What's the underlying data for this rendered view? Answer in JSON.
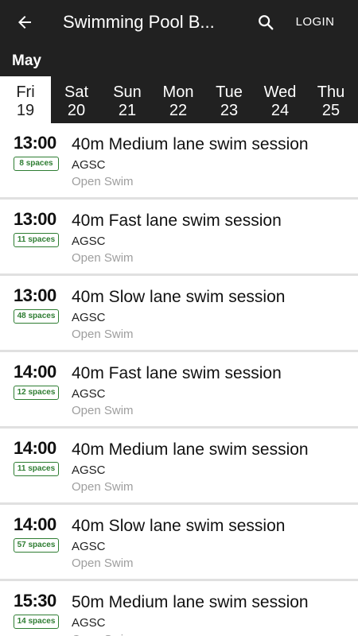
{
  "header": {
    "title": "Swimming Pool B...",
    "login_label": "LOGIN",
    "back_icon": "arrow-left-icon",
    "search_icon": "search-icon",
    "background": "#212121"
  },
  "month": "May",
  "days": [
    {
      "name": "Fri",
      "num": "19",
      "selected": true
    },
    {
      "name": "Sat",
      "num": "20",
      "selected": false
    },
    {
      "name": "Sun",
      "num": "21",
      "selected": false
    },
    {
      "name": "Mon",
      "num": "22",
      "selected": false
    },
    {
      "name": "Tue",
      "num": "23",
      "selected": false
    },
    {
      "name": "Wed",
      "num": "24",
      "selected": false
    },
    {
      "name": "Thu",
      "num": "25",
      "selected": false
    }
  ],
  "sessions": [
    {
      "time": "13:00",
      "spaces": "8 spaces",
      "title": "40m Medium lane swim session",
      "venue": "AGSC",
      "type": "Open Swim"
    },
    {
      "time": "13:00",
      "spaces": "11 spaces",
      "title": "40m Fast lane swim session",
      "venue": "AGSC",
      "type": "Open Swim"
    },
    {
      "time": "13:00",
      "spaces": "48 spaces",
      "title": "40m Slow lane swim session",
      "venue": "AGSC",
      "type": "Open Swim"
    },
    {
      "time": "14:00",
      "spaces": "12 spaces",
      "title": "40m Fast lane swim session",
      "venue": "AGSC",
      "type": "Open Swim"
    },
    {
      "time": "14:00",
      "spaces": "11 spaces",
      "title": "40m Medium lane swim session",
      "venue": "AGSC",
      "type": "Open Swim"
    },
    {
      "time": "14:00",
      "spaces": "57 spaces",
      "title": "40m Slow lane swim session",
      "venue": "AGSC",
      "type": "Open Swim"
    },
    {
      "time": "15:30",
      "spaces": "14 spaces",
      "title": "50m Medium lane swim session",
      "venue": "AGSC",
      "type": "Open Swim"
    }
  ],
  "colors": {
    "accent_dark": "#212121",
    "spaces_green": "#2e7d32",
    "muted_text": "#9e9e9e"
  }
}
